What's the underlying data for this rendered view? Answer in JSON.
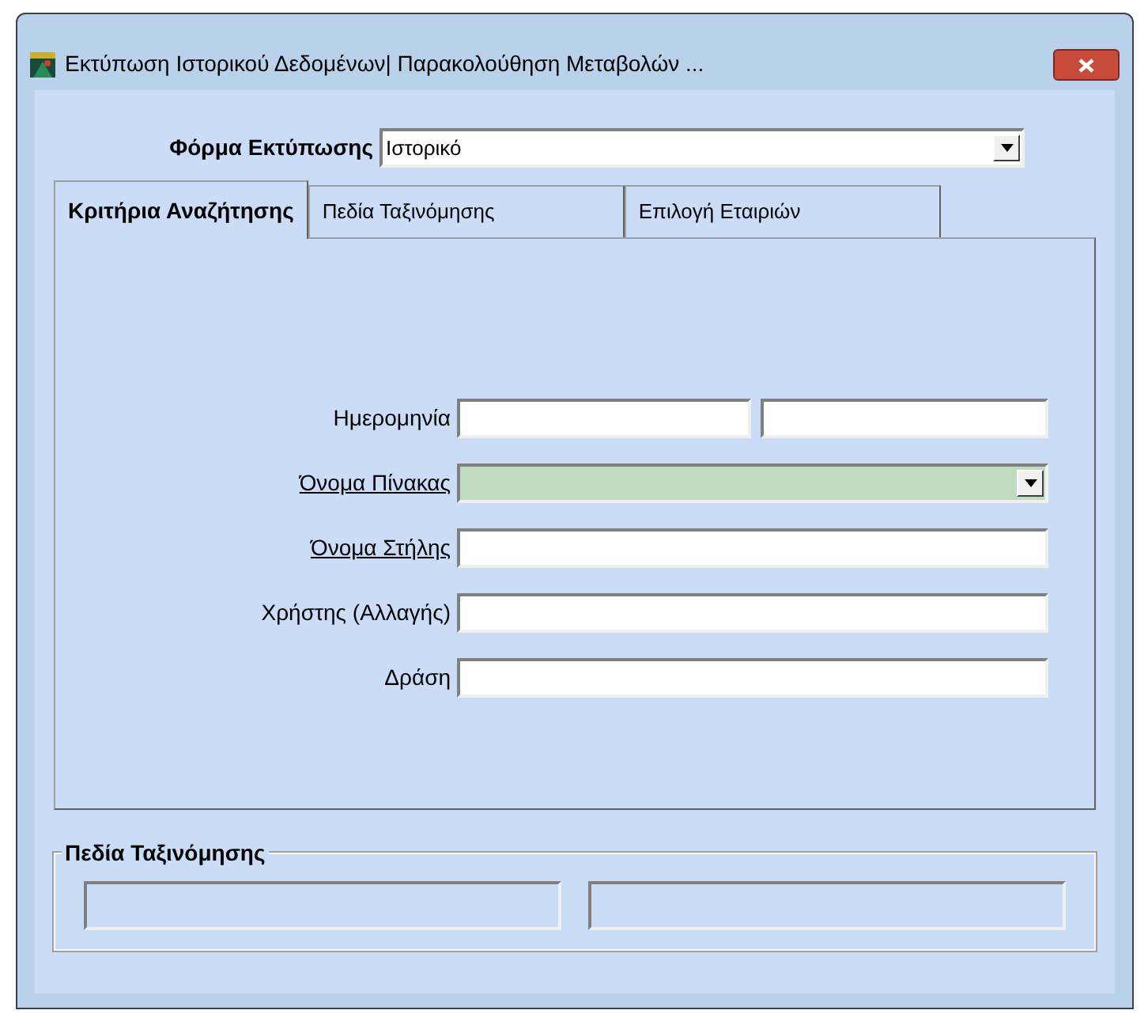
{
  "window": {
    "title": "Εκτύπωση Ιστορικού Δεδομένων| Παρακολούθηση Μεταβολών ..."
  },
  "print_form": {
    "label": "Φόρμα Εκτύπωσης",
    "value": "Ιστορικό"
  },
  "tabs": [
    {
      "label": "Κριτήρια Αναζήτησης",
      "selected": true
    },
    {
      "label": "Πεδία Ταξινόμησης",
      "selected": false
    },
    {
      "label": "Επιλογή Εταιριών",
      "selected": false
    }
  ],
  "criteria": [
    {
      "label": "Ημερομηνία",
      "kind": "range",
      "underlined": false
    },
    {
      "label": "Όνομα Πίνακας",
      "kind": "combo",
      "underlined": true
    },
    {
      "label": "Όνομα Στήλης",
      "kind": "text",
      "underlined": true
    },
    {
      "label": "Χρήστης (Αλλαγής)",
      "kind": "text",
      "underlined": false
    },
    {
      "label": "Δράση",
      "kind": "text",
      "underlined": false
    }
  ],
  "sort_fields": {
    "title": "Πεδία Ταξινόμησης",
    "fields": [
      {
        "disabled": true
      },
      {
        "disabled": true
      }
    ]
  }
}
